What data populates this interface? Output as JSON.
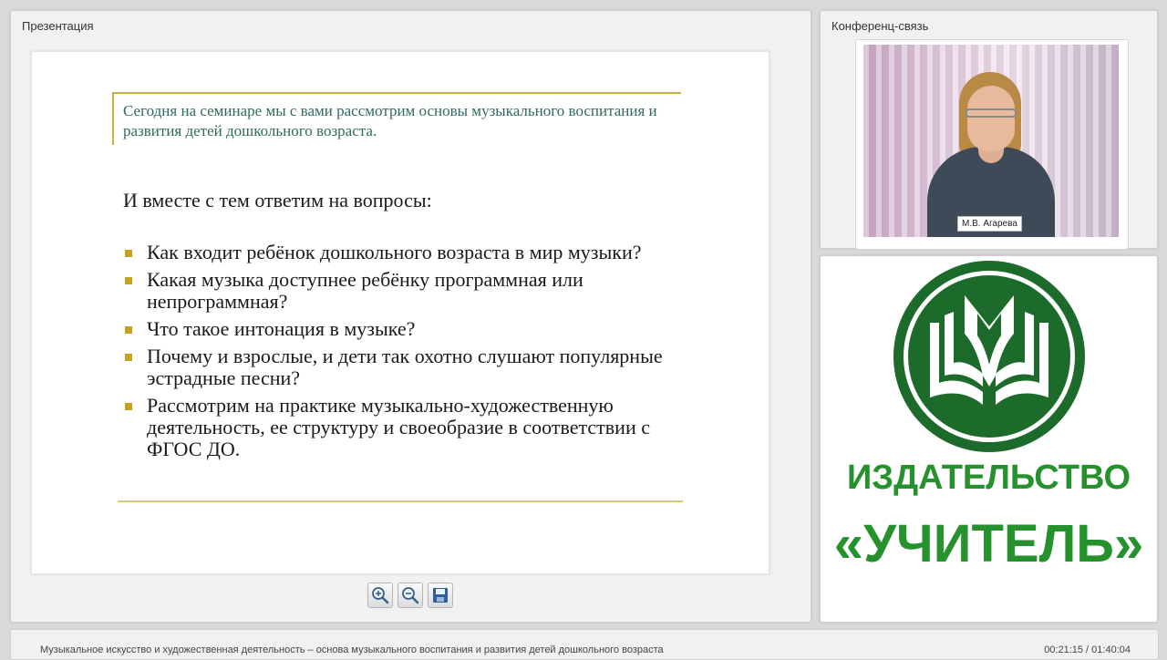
{
  "presentation": {
    "title": "Презентация",
    "slide": {
      "intro": "Сегодня на семинаре мы с вами рассмотрим основы музыкального воспитания и развития детей дошкольного возраста.",
      "subtitle": "И вместе с тем ответим на вопросы:",
      "items": [
        "Как входит ребёнок дошкольного возраста в мир музыки?",
        "Какая музыка доступнее ребёнку программная или непрограммная?",
        "Что такое интонация в музыке?",
        "Почему и взрослые, и дети так охотно слушают популярные эстрадные песни?",
        "Рассмотрим на практике музыкально-художественную деятельность, ее структуру и своеобразие в соответствии с ФГОС ДО."
      ],
      "bullet_color": "#c9a21c",
      "accent_color": "#c9b038"
    },
    "toolbar": {
      "zoom_in_icon": "zoom-in-icon",
      "zoom_out_icon": "zoom-out-icon",
      "save_icon": "save-icon"
    }
  },
  "conference": {
    "title": "Конференц-связь",
    "speaker_name": "М.В. Агарева"
  },
  "logo": {
    "line1": "ИЗДАТЕЛЬСТВО",
    "line2": "«УЧИТЕЛЬ»",
    "brand_color": "#1c6b2a",
    "text_color": "#26922e"
  },
  "footer": {
    "title": "Музыкальное искусство и художественная деятельность – основа музыкального воспитания и развития детей дошкольного возраста",
    "time": "00:21:15 / 01:40:04"
  }
}
